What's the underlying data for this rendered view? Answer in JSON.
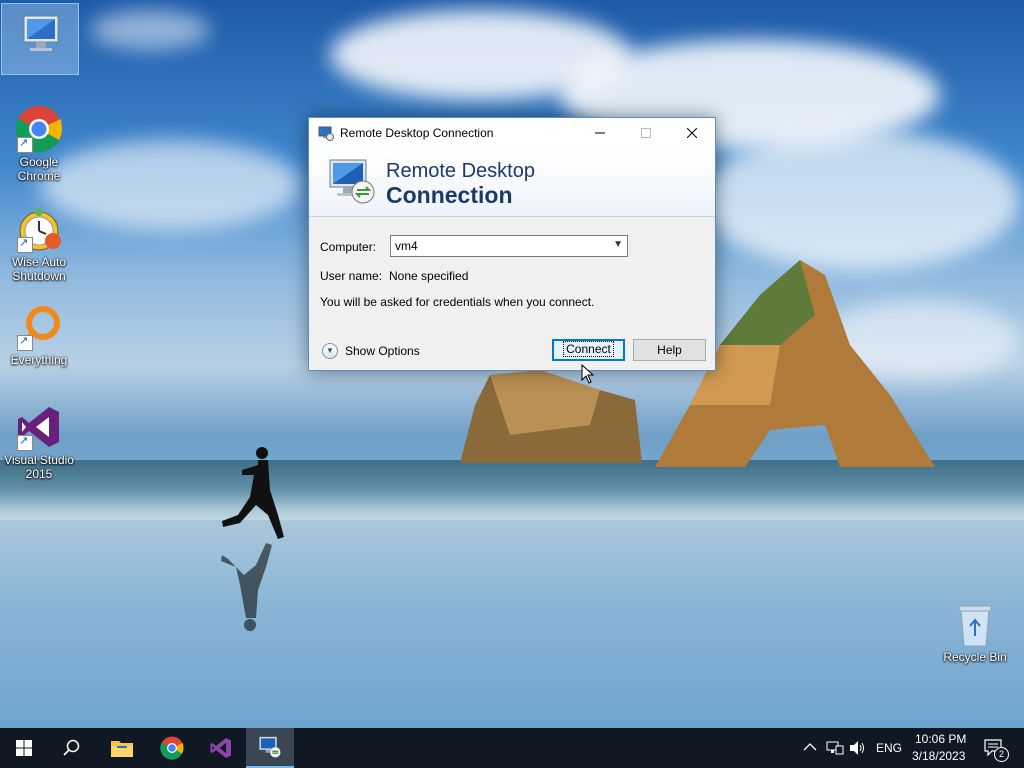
{
  "desktop": {
    "icons": [
      {
        "label": "",
        "icon": "this-pc-icon"
      },
      {
        "label": "Google Chrome",
        "icon": "chrome-icon"
      },
      {
        "label": "Wise Auto Shutdown",
        "icon": "wise-auto-shutdown-icon"
      },
      {
        "label": "Everything",
        "icon": "everything-icon"
      },
      {
        "label": "Visual Studio 2015",
        "icon": "visual-studio-icon"
      },
      {
        "label": "Recycle Bin",
        "icon": "recycle-bin-icon"
      }
    ]
  },
  "dialog": {
    "title": "Remote Desktop Connection",
    "banner_line1": "Remote Desktop",
    "banner_line2": "Connection",
    "computer_label": "Computer:",
    "computer_value": "vm4",
    "username_label": "User name:",
    "username_value": "None specified",
    "credentials_note": "You will be asked for credentials when you connect.",
    "show_options_label": "Show Options",
    "connect_label": "Connect",
    "help_label": "Help"
  },
  "taskbar": {
    "items": [
      "start-icon",
      "search-icon",
      "file-explorer-icon",
      "chrome-icon",
      "visual-studio-icon",
      "remote-desktop-icon"
    ],
    "language": "ENG",
    "time": "10:06 PM",
    "date": "3/18/2023",
    "notification_count": "2"
  },
  "colors": {
    "accent": "#0078d7",
    "taskbar": "#101923",
    "banner_text": "#1b3a6b"
  }
}
